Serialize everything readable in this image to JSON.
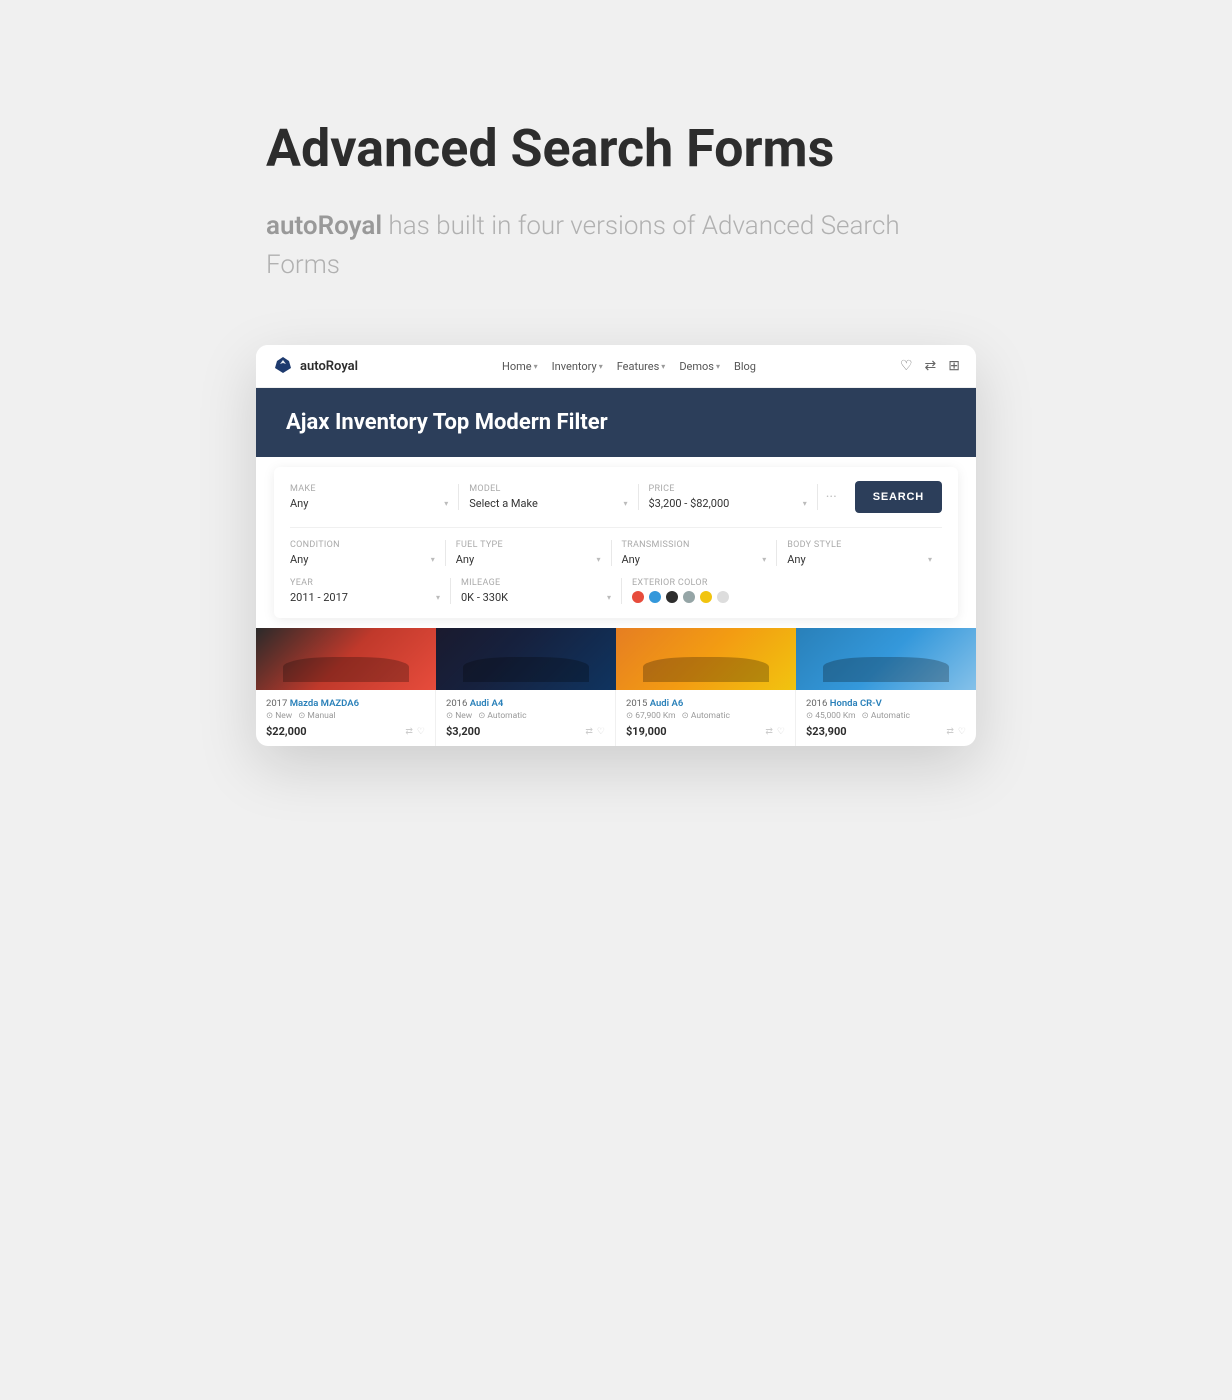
{
  "page": {
    "title": "Advanced Search Forms",
    "subtitle_brand": "autoRoyal",
    "subtitle_text": " has built in four versions of Advanced Search Forms"
  },
  "browser": {
    "brand_name": "autoRoyal",
    "nav_items": [
      {
        "label": "Home",
        "has_chevron": true
      },
      {
        "label": "Inventory",
        "has_chevron": true
      },
      {
        "label": "Features",
        "has_chevron": true
      },
      {
        "label": "Demos",
        "has_chevron": true
      },
      {
        "label": "Blog",
        "has_chevron": false
      }
    ]
  },
  "hero": {
    "title": "Ajax Inventory Top Modern Filter"
  },
  "search": {
    "search_button_label": "SEARCH",
    "row1": [
      {
        "label": "Make",
        "value": "Any"
      },
      {
        "label": "Model",
        "value": "Select a Make"
      },
      {
        "label": "Price",
        "value": "$3,200 - $82,000"
      }
    ],
    "row2": [
      {
        "label": "Condition",
        "value": "Any"
      },
      {
        "label": "Fuel type",
        "value": "Any"
      },
      {
        "label": "Transmission",
        "value": "Any"
      },
      {
        "label": "Body Style",
        "value": "Any"
      }
    ],
    "row3_year": {
      "label": "Year",
      "value": "2011 - 2017"
    },
    "row3_mileage": {
      "label": "Mileage",
      "value": "0K - 330K"
    },
    "exterior_color_label": "Exterior color",
    "colors": [
      "#e74c3c",
      "#3498db",
      "#2d2d2d",
      "#95a5a6",
      "#f1c40f",
      "#bdc3c7"
    ]
  },
  "cars": [
    {
      "year": "2017",
      "make": "Mazda MAZDA6",
      "condition": "New",
      "transmission": "Manual",
      "price": "$22,000",
      "img_class": "car-img-1"
    },
    {
      "year": "2016",
      "make": "Audi A4",
      "condition": "New",
      "transmission": "Automatic",
      "price": "$3,200",
      "img_class": "car-img-2"
    },
    {
      "year": "2015",
      "make": "Audi A6",
      "condition": "",
      "mileage": "67,900 Km",
      "transmission": "Automatic",
      "price": "$19,000",
      "img_class": "car-img-3"
    },
    {
      "year": "2016",
      "make": "Honda CR-V",
      "condition": "",
      "mileage": "45,000 Km",
      "transmission": "Automatic",
      "price": "$23,900",
      "img_class": "car-img-4"
    }
  ]
}
